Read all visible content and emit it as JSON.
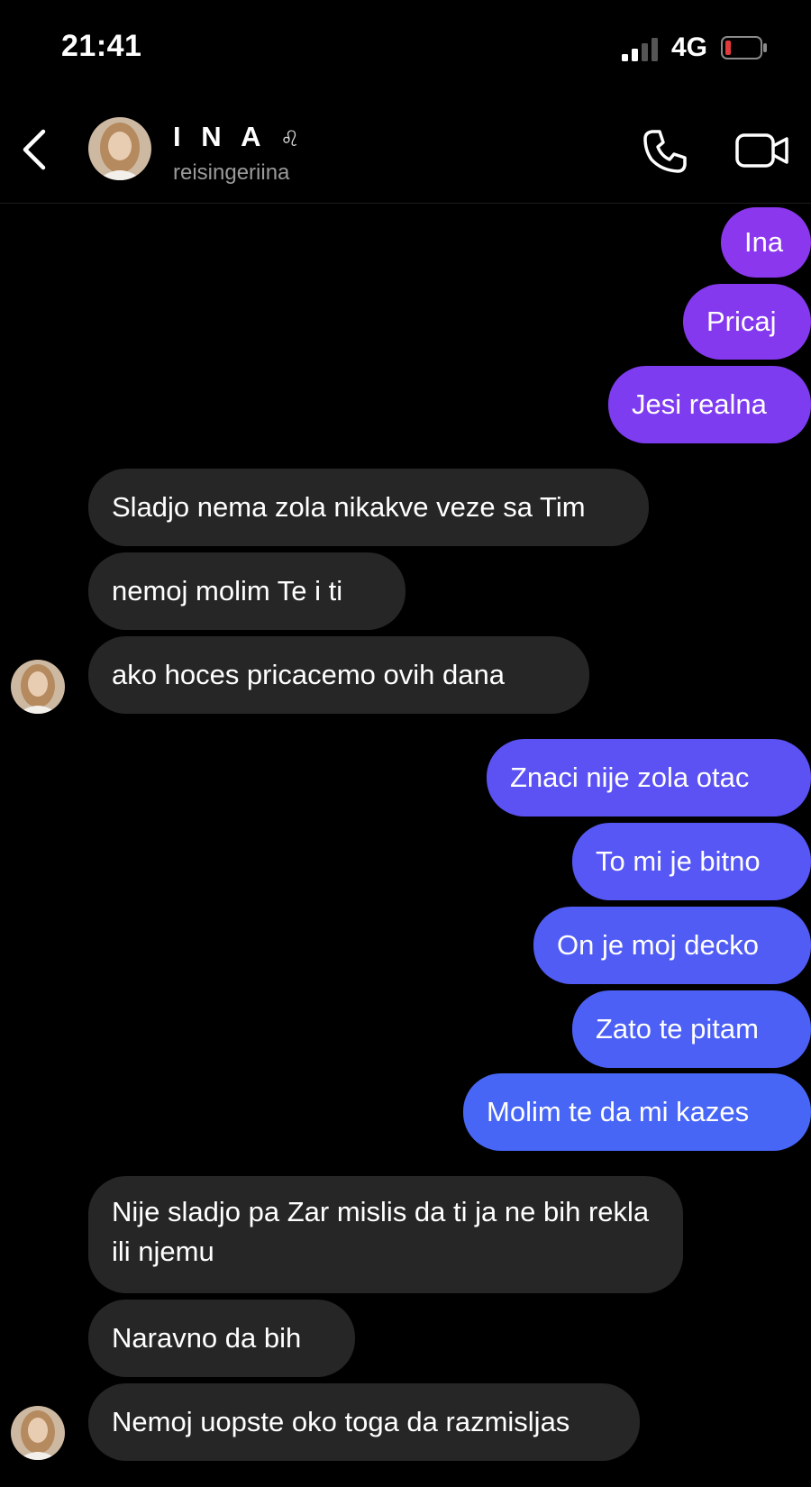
{
  "status": {
    "time": "21:41",
    "network": "4G"
  },
  "header": {
    "name": "I N A",
    "emoji": "♌",
    "username": "reisingeriina"
  },
  "colors": {
    "accent_purple": "#7b3cf0",
    "accent_blue": "#4a63f5",
    "received_bubble": "#262626",
    "battery_low": "#e03a3a"
  },
  "icons": [
    "back-chevron-icon",
    "phone-icon",
    "video-camera-icon",
    "signal-icon",
    "battery-icon"
  ],
  "messages": [
    {
      "from": "me",
      "text": "Ina"
    },
    {
      "from": "me",
      "text": "Pricaj"
    },
    {
      "from": "me",
      "text": "Jesi realna"
    },
    {
      "from": "them",
      "text": "Sladjo nema zola nikakve veze sa Tim"
    },
    {
      "from": "them",
      "text": "nemoj molim Te i ti"
    },
    {
      "from": "them",
      "text": "ako hoces pricacemo ovih dana"
    },
    {
      "from": "me",
      "text": "Znaci nije zola otac"
    },
    {
      "from": "me",
      "text": "To mi je bitno"
    },
    {
      "from": "me",
      "text": "On je moj decko"
    },
    {
      "from": "me",
      "text": "Zato te pitam"
    },
    {
      "from": "me",
      "text": "Molim te da mi kazes"
    },
    {
      "from": "them",
      "text": "Nije sladjo pa Zar mislis da ti ja ne bih rekla ili njemu"
    },
    {
      "from": "them",
      "text": "Naravno da bih"
    },
    {
      "from": "them",
      "text": "Nemoj uopste oko toga da razmisljas"
    }
  ]
}
